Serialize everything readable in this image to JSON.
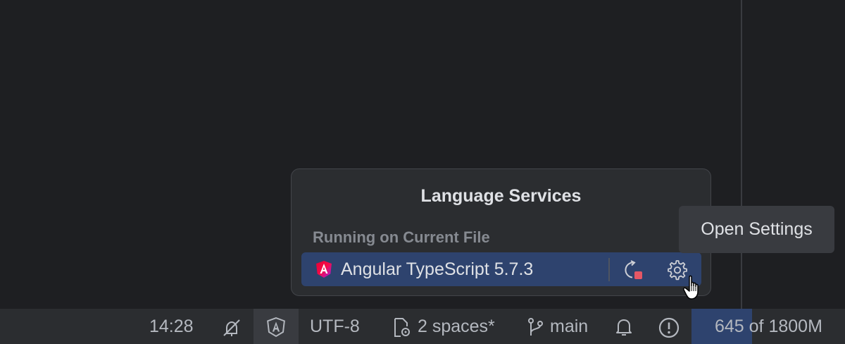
{
  "popup": {
    "title": "Language Services",
    "section_label": "Running on Current File",
    "service": {
      "name": "Angular TypeScript 5.7.3",
      "icon": "angular-icon",
      "actions": [
        "restart-icon",
        "gear-icon"
      ]
    }
  },
  "tooltip": {
    "text": "Open Settings"
  },
  "statusbar": {
    "position": "14:28",
    "encoding": "UTF-8",
    "indent": "2 spaces*",
    "branch": "main",
    "memory": "645 of 1800M",
    "icons": [
      "readonly-toggle-icon",
      "angular-language-service-icon",
      "indent-settings-icon",
      "git-branch-icon",
      "notifications-bell-icon",
      "problems-icon"
    ]
  },
  "colors": {
    "background": "#1e1f22",
    "popup_bg": "#2b2d30",
    "selection": "#2e436e",
    "tooltip_bg": "#393b40",
    "text": "#dfe1e5",
    "muted": "#868a91",
    "accent_red": "#e55765"
  }
}
